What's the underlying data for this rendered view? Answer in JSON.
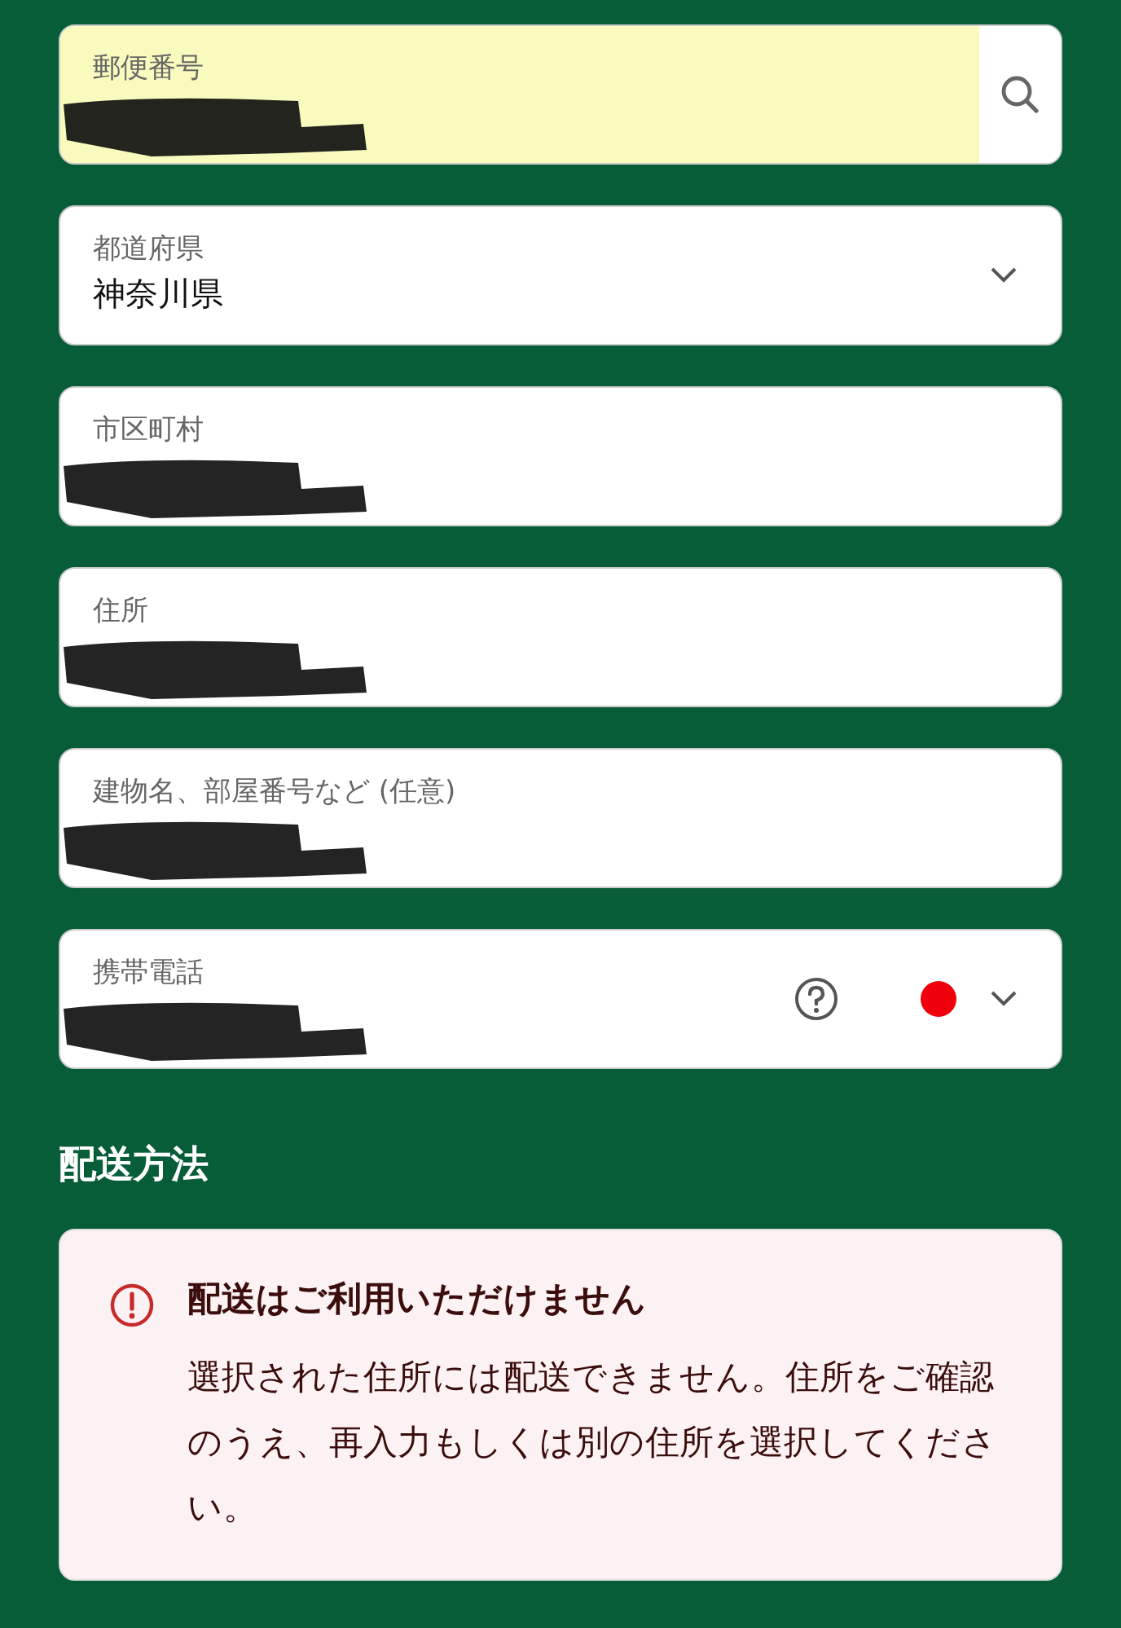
{
  "address_fields": [
    {
      "kind": "search",
      "label": "郵便番号",
      "autofilled": true,
      "redacted": true
    },
    {
      "kind": "select",
      "label": "都道府県",
      "value": "神奈川県",
      "autofilled": false,
      "redacted": false
    },
    {
      "kind": "text",
      "label": "市区町村",
      "autofilled": false,
      "redacted": true
    },
    {
      "kind": "text",
      "label": "住所",
      "autofilled": false,
      "redacted": true
    },
    {
      "kind": "text",
      "label": "建物名、部屋番号など (任意)",
      "autofilled": false,
      "redacted": true
    },
    {
      "kind": "phone",
      "label": "携帯電話",
      "autofilled": false,
      "redacted": true
    }
  ],
  "shipping": {
    "heading": "配送方法",
    "alert": {
      "title": "配送はご利用いただけません",
      "message": "選択された住所には配送できません。住所をご確認のうえ、再入力もしくは別の住所を選択してください。"
    }
  }
}
